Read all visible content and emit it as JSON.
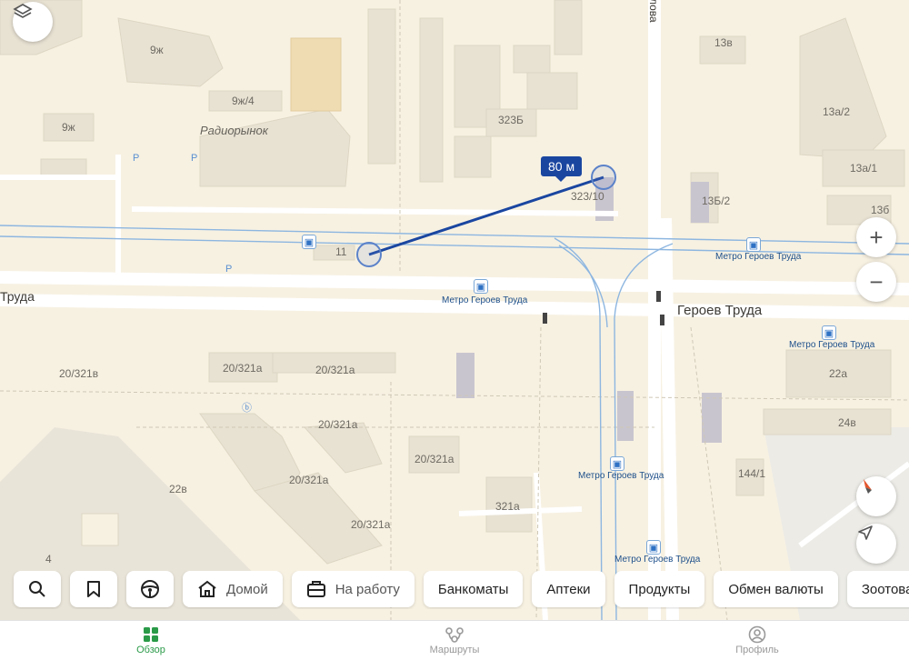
{
  "map": {
    "buildings": [
      "9ж",
      "9ж",
      "9ж/4",
      "323Б",
      "323/10",
      "13в",
      "13а/2",
      "13а/1",
      "13б",
      "13Б/2",
      "11",
      "20/321в",
      "20/321а",
      "20/321а",
      "20/321а",
      "20/321а",
      "20/321а",
      "20/321а",
      "321а",
      "22а",
      "24в",
      "144/1",
      "22в",
      "4"
    ],
    "district": "Радиорынок",
    "streets": {
      "left": "Труда",
      "main": "Героев Труда",
      "vertical": "лова"
    },
    "metro_label": "Метро Героев Труда",
    "measure": {
      "label": "80 м"
    }
  },
  "controls": {
    "layers_icon": "layers-icon",
    "zoom_in": "+",
    "zoom_out": "−",
    "compass_icon": "compass-icon",
    "locate_icon": "locate-icon"
  },
  "chips": [
    {
      "icon": "search-icon",
      "label": ""
    },
    {
      "icon": "bookmark-icon",
      "label": ""
    },
    {
      "icon": "steering-wheel-icon",
      "label": ""
    },
    {
      "icon": "home-icon",
      "label": "Домой"
    },
    {
      "icon": "briefcase-icon",
      "label": "На работу"
    },
    {
      "label": "Банкоматы"
    },
    {
      "label": "Аптеки"
    },
    {
      "label": "Продукты"
    },
    {
      "label": "Обмен валюты"
    },
    {
      "label": "Зоотовары"
    }
  ],
  "tabs": [
    {
      "icon": "overview-icon",
      "label": "Обзор",
      "active": true
    },
    {
      "icon": "routes-icon",
      "label": "Маршруты"
    },
    {
      "icon": "profile-icon",
      "label": "Профиль"
    }
  ],
  "colors": {
    "accent": "#2a9a48",
    "measure": "#1a46a0",
    "transit": "#7aa7d6"
  }
}
